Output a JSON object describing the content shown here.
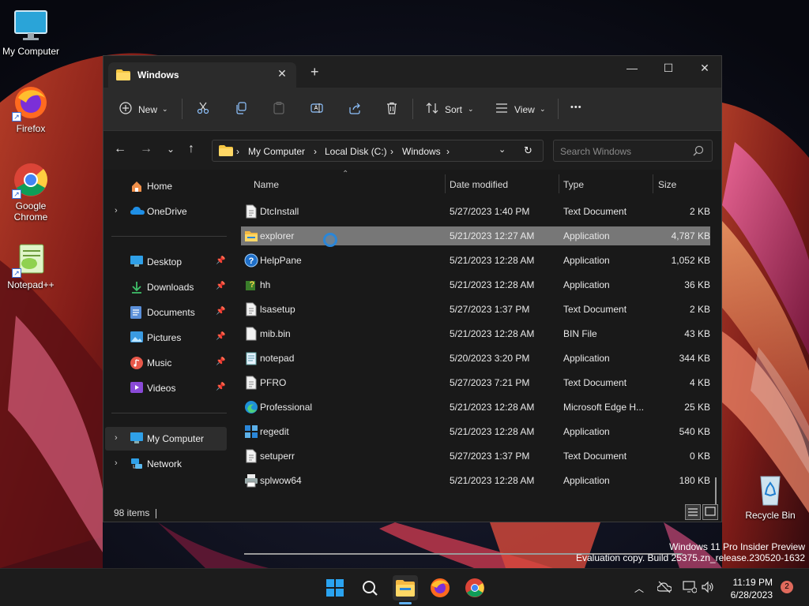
{
  "desktop": {
    "icons": [
      {
        "label": "My Computer"
      },
      {
        "label": "Firefox"
      },
      {
        "label": "Google Chrome"
      },
      {
        "label": "Notepad++"
      },
      {
        "label": "Recycle Bin"
      }
    ],
    "watermark": {
      "line1": "Windows 11 Pro Insider Preview",
      "line2": "Evaluation copy. Build 25375.zn_release.230520-1632"
    }
  },
  "window": {
    "tab_title": "Windows",
    "tab_close": "✕",
    "new_tab": "+",
    "controls": {
      "minimize": "—",
      "maximize": "☐",
      "close": "✕"
    },
    "toolbar": {
      "new_label": "New",
      "sort_label": "Sort",
      "view_label": "View",
      "more_label": "•••"
    },
    "breadcrumb": [
      "My Computer",
      "Local Disk (C:)",
      "Windows"
    ],
    "breadcrumb_sep": "›",
    "search_placeholder": "Search Windows"
  },
  "navpane": {
    "items": [
      {
        "label": "Home",
        "icon": "home-icon"
      },
      {
        "label": "OneDrive",
        "icon": "cloud-icon"
      },
      {
        "label": "Desktop",
        "icon": "desktop-icon",
        "pinned": true
      },
      {
        "label": "Downloads",
        "icon": "download-icon",
        "pinned": true
      },
      {
        "label": "Documents",
        "icon": "documents-icon",
        "pinned": true
      },
      {
        "label": "Pictures",
        "icon": "pictures-icon",
        "pinned": true
      },
      {
        "label": "Music",
        "icon": "music-icon",
        "pinned": true
      },
      {
        "label": "Videos",
        "icon": "videos-icon",
        "pinned": true
      },
      {
        "label": "My Computer",
        "icon": "computer-icon"
      },
      {
        "label": "Network",
        "icon": "network-icon"
      }
    ]
  },
  "filelist": {
    "columns": {
      "name": "Name",
      "date": "Date modified",
      "type": "Type",
      "size": "Size"
    },
    "rows": [
      {
        "name": "DtcInstall",
        "date": "5/27/2023 1:40 PM",
        "type": "Text Document",
        "size": "2 KB",
        "icon": "text-file-icon"
      },
      {
        "name": "explorer",
        "date": "5/21/2023 12:27 AM",
        "type": "Application",
        "size": "4,787 KB",
        "icon": "explorer-icon",
        "selected": true
      },
      {
        "name": "HelpPane",
        "date": "5/21/2023 12:28 AM",
        "type": "Application",
        "size": "1,052 KB",
        "icon": "help-icon"
      },
      {
        "name": "hh",
        "date": "5/21/2023 12:28 AM",
        "type": "Application",
        "size": "36 KB",
        "icon": "help-file-icon"
      },
      {
        "name": "lsasetup",
        "date": "5/27/2023 1:37 PM",
        "type": "Text Document",
        "size": "2 KB",
        "icon": "text-file-icon"
      },
      {
        "name": "mib.bin",
        "date": "5/21/2023 12:28 AM",
        "type": "BIN File",
        "size": "43 KB",
        "icon": "file-icon"
      },
      {
        "name": "notepad",
        "date": "5/20/2023 3:20 PM",
        "type": "Application",
        "size": "344 KB",
        "icon": "notepad-icon"
      },
      {
        "name": "PFRO",
        "date": "5/27/2023 7:21 PM",
        "type": "Text Document",
        "size": "4 KB",
        "icon": "text-file-icon"
      },
      {
        "name": "Professional",
        "date": "5/21/2023 12:28 AM",
        "type": "Microsoft Edge H...",
        "size": "25 KB",
        "icon": "edge-icon"
      },
      {
        "name": "regedit",
        "date": "5/21/2023 12:28 AM",
        "type": "Application",
        "size": "540 KB",
        "icon": "regedit-icon"
      },
      {
        "name": "setuperr",
        "date": "5/27/2023 1:37 PM",
        "type": "Text Document",
        "size": "0 KB",
        "icon": "text-file-icon"
      },
      {
        "name": "splwow64",
        "date": "5/21/2023 12:28 AM",
        "type": "Application",
        "size": "180 KB",
        "icon": "printer-icon"
      }
    ]
  },
  "status": {
    "item_count": "98 items"
  },
  "taskbar": {
    "clock_time": "11:19 PM",
    "clock_date": "6/28/2023",
    "notification_count": "2"
  }
}
